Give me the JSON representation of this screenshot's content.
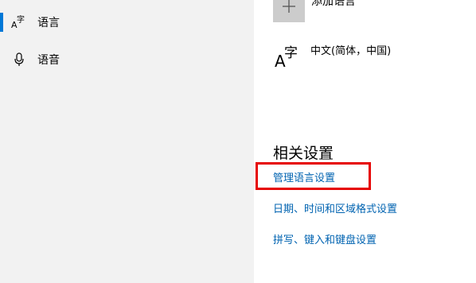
{
  "sidebar": {
    "items": [
      {
        "label": "语言",
        "icon": "language-icon",
        "active": true
      },
      {
        "label": "语音",
        "icon": "microphone-icon",
        "active": false
      }
    ]
  },
  "main": {
    "add_language_label": "添加语言",
    "languages": [
      {
        "name": "中文(简体，中国)"
      }
    ],
    "related_settings": {
      "title": "相关设置",
      "links": [
        "管理语言设置",
        "日期、时间和区域格式设置",
        "拼写、键入和键盘设置"
      ]
    }
  },
  "colors": {
    "accent": "#0078d7",
    "link": "#0063b1",
    "highlight": "#e60000",
    "sidebar_bg": "#f2f2f2"
  }
}
